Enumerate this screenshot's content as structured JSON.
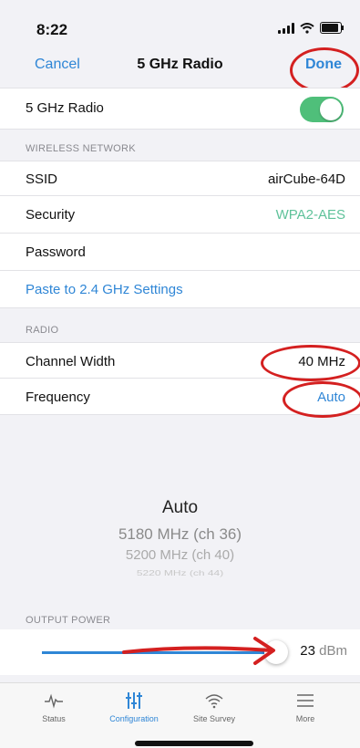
{
  "status": {
    "time": "8:22"
  },
  "nav": {
    "cancel": "Cancel",
    "title": "5 GHz Radio",
    "done": "Done"
  },
  "radio_toggle": {
    "label": "5 GHz Radio",
    "on": true
  },
  "wireless": {
    "header": "WIRELESS NETWORK",
    "ssid_label": "SSID",
    "ssid_value": "airCube-64D",
    "security_label": "Security",
    "security_value": "WPA2-AES",
    "password_label": "Password",
    "paste_link": "Paste to 2.4 GHz Settings"
  },
  "radio": {
    "header": "RADIO",
    "channel_width_label": "Channel Width",
    "channel_width_value": "40 MHz",
    "frequency_label": "Frequency",
    "frequency_value": "Auto"
  },
  "picker": {
    "selected": "Auto",
    "options": [
      "5180 MHz (ch 36)",
      "5200 MHz (ch 40)",
      "5220 MHz (ch 44)"
    ]
  },
  "output_power": {
    "header": "OUTPUT POWER",
    "value": "23",
    "unit": "dBm"
  },
  "tabs": [
    {
      "label": "Status",
      "icon": "activity-icon"
    },
    {
      "label": "Configuration",
      "icon": "sliders-icon",
      "active": true
    },
    {
      "label": "Site Survey",
      "icon": "wifi-icon"
    },
    {
      "label": "More",
      "icon": "menu-icon"
    }
  ],
  "colors": {
    "accent": "#2f86d6",
    "toggle_on": "#4fbf7a",
    "annotation": "#d42020",
    "security_value": "#5fc29a"
  }
}
